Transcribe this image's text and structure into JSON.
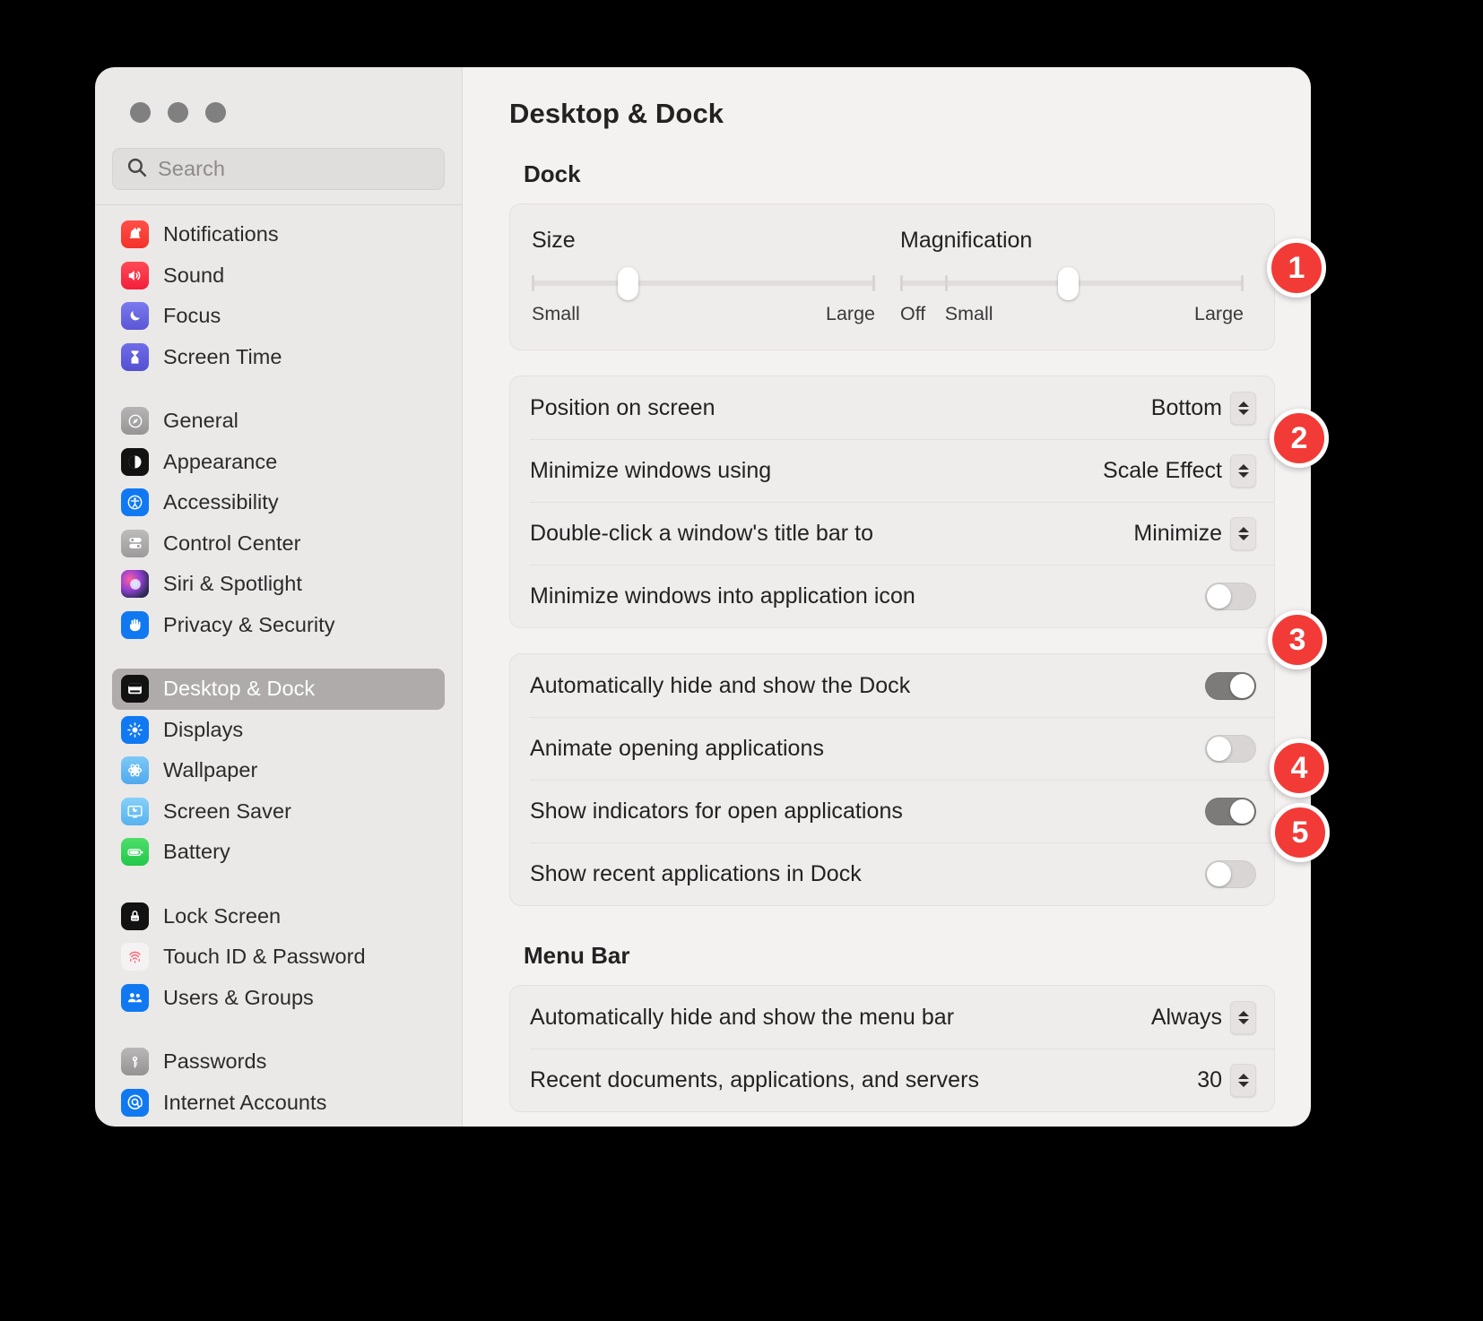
{
  "window": {
    "traffic_lights": [
      "close",
      "minimize",
      "zoom"
    ]
  },
  "search": {
    "placeholder": "Search",
    "value": "",
    "icon": "search-icon"
  },
  "sidebar": {
    "groups": [
      {
        "items": [
          {
            "label": "Notifications",
            "icon": "notifications-icon",
            "selected": false
          },
          {
            "label": "Sound",
            "icon": "sound-icon",
            "selected": false
          },
          {
            "label": "Focus",
            "icon": "focus-icon",
            "selected": false
          },
          {
            "label": "Screen Time",
            "icon": "screen-time-icon",
            "selected": false
          }
        ]
      },
      {
        "items": [
          {
            "label": "General",
            "icon": "general-icon",
            "selected": false
          },
          {
            "label": "Appearance",
            "icon": "appearance-icon",
            "selected": false
          },
          {
            "label": "Accessibility",
            "icon": "accessibility-icon",
            "selected": false
          },
          {
            "label": "Control Center",
            "icon": "control-center-icon",
            "selected": false
          },
          {
            "label": "Siri & Spotlight",
            "icon": "siri-icon",
            "selected": false
          },
          {
            "label": "Privacy & Security",
            "icon": "privacy-icon",
            "selected": false
          }
        ]
      },
      {
        "items": [
          {
            "label": "Desktop & Dock",
            "icon": "desktop-dock-icon",
            "selected": true
          },
          {
            "label": "Displays",
            "icon": "displays-icon",
            "selected": false
          },
          {
            "label": "Wallpaper",
            "icon": "wallpaper-icon",
            "selected": false
          },
          {
            "label": "Screen Saver",
            "icon": "screen-saver-icon",
            "selected": false
          },
          {
            "label": "Battery",
            "icon": "battery-icon",
            "selected": false
          }
        ]
      },
      {
        "items": [
          {
            "label": "Lock Screen",
            "icon": "lock-screen-icon",
            "selected": false
          },
          {
            "label": "Touch ID & Password",
            "icon": "touch-id-icon",
            "selected": false
          },
          {
            "label": "Users & Groups",
            "icon": "users-groups-icon",
            "selected": false
          }
        ]
      },
      {
        "items": [
          {
            "label": "Passwords",
            "icon": "passwords-icon",
            "selected": false
          },
          {
            "label": "Internet Accounts",
            "icon": "internet-accounts-icon",
            "selected": false
          }
        ]
      }
    ]
  },
  "main": {
    "title": "Desktop & Dock",
    "dock_section_title": "Dock",
    "menu_bar_section_title": "Menu Bar",
    "sliders": [
      {
        "name": "size",
        "label": "Size",
        "min_label": "Small",
        "max_label": "Large",
        "value_percent": 28
      },
      {
        "name": "magnification",
        "label": "Magnification",
        "off_label": "Off",
        "min_label": "Small",
        "max_label": "Large",
        "value_percent": 49
      }
    ],
    "dock_rows": [
      {
        "label": "Position on screen",
        "type": "popup",
        "value": "Bottom"
      },
      {
        "label": "Minimize windows using",
        "type": "popup",
        "value": "Scale Effect"
      },
      {
        "label": "Double-click a window's title bar to",
        "type": "popup",
        "value": "Minimize"
      },
      {
        "label": "Minimize windows into application icon",
        "type": "toggle",
        "value": "off"
      }
    ],
    "dock_rows_2": [
      {
        "label": "Automatically hide and show the Dock",
        "type": "toggle",
        "value": "on"
      },
      {
        "label": "Animate opening applications",
        "type": "toggle",
        "value": "off"
      },
      {
        "label": "Show indicators for open applications",
        "type": "toggle",
        "value": "on"
      },
      {
        "label": "Show recent applications in Dock",
        "type": "toggle",
        "value": "off"
      }
    ],
    "menu_bar_rows": [
      {
        "label": "Automatically hide and show the menu bar",
        "type": "popup",
        "value": "Always"
      },
      {
        "label": "Recent documents, applications, and servers",
        "type": "popup",
        "value": "30"
      }
    ]
  },
  "annotations": {
    "accent_color": "#f23b37",
    "badges": [
      {
        "number": "1",
        "target": "magnification-slider"
      },
      {
        "number": "2",
        "target": "minimize-windows-using-popup"
      },
      {
        "number": "3",
        "target": "automatically-hide-dock-toggle"
      },
      {
        "number": "4",
        "target": "show-indicators-toggle"
      },
      {
        "number": "5",
        "target": "show-recent-apps-toggle"
      }
    ]
  }
}
